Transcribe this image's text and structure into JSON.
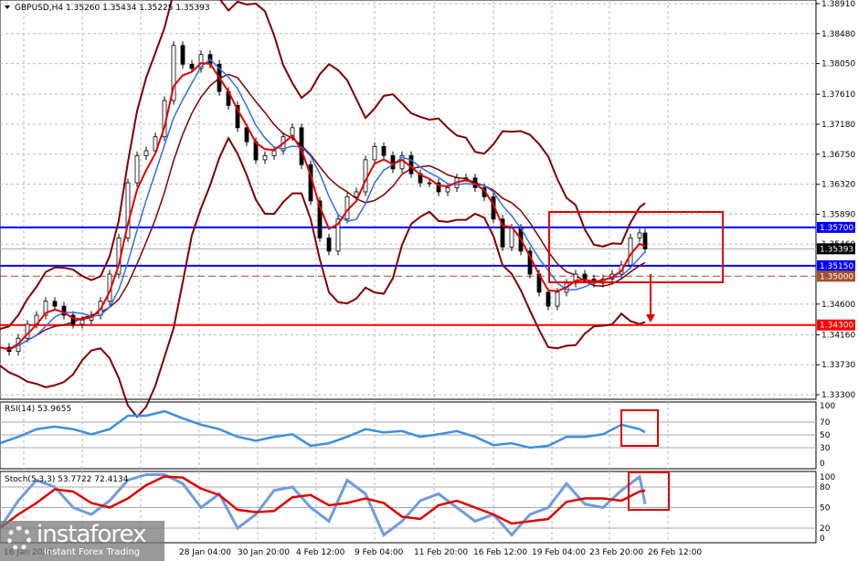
{
  "chart_data": [
    {
      "type": "candlestick",
      "title": "GBPUSD,H4",
      "ohlc_header": {
        "symbol": "GBPUSD,H4",
        "open": "1.35260",
        "high": "1.35434",
        "low": "1.35225",
        "close": "1.35393"
      },
      "ylim": [
        1.333,
        1.3891
      ],
      "y_ticks": [
        "1.38910",
        "1.38480",
        "1.38050",
        "1.37610",
        "1.37180",
        "1.36750",
        "1.36320",
        "1.35890",
        "1.35460",
        "1.34600",
        "1.34160",
        "1.33730",
        "1.33300"
      ],
      "x_ticks": [
        "16 Jan 2026",
        "28 Jan 04:00",
        "30 Jan 20:00",
        "4 Feb 12:00",
        "9 Feb 04:00",
        "11 Feb 20:00",
        "16 Feb 12:00",
        "19 Feb 04:00",
        "23 Feb 20:00",
        "26 Feb 12:00"
      ],
      "closes": [
        1.3398,
        1.3392,
        1.3411,
        1.3431,
        1.3444,
        1.3464,
        1.3457,
        1.3444,
        1.3431,
        1.3437,
        1.3444,
        1.3464,
        1.3503,
        1.3555,
        1.3634,
        1.3673,
        1.368,
        1.37,
        1.3752,
        1.3831,
        1.3804,
        1.3798,
        1.3818,
        1.3804,
        1.3765,
        1.3745,
        1.3713,
        1.3693,
        1.3667,
        1.3673,
        1.368,
        1.37,
        1.3713,
        1.366,
        1.3608,
        1.3555,
        1.3536,
        1.3582,
        1.3614,
        1.3621,
        1.3667,
        1.3686,
        1.3673,
        1.3654,
        1.3673,
        1.3647,
        1.3634,
        1.3634,
        1.3621,
        1.3627,
        1.3641,
        1.3641,
        1.3627,
        1.3614,
        1.3582,
        1.3542,
        1.3569,
        1.3536,
        1.3503,
        1.3477,
        1.3457,
        1.3477,
        1.349,
        1.3503,
        1.3496,
        1.349,
        1.3496,
        1.3503,
        1.3516,
        1.3555,
        1.3562,
        1.35393
      ],
      "levels": [
        {
          "price": 1.357,
          "label": "1.35700",
          "color": "#0000ff"
        },
        {
          "price": 1.3515,
          "label": "1.35150",
          "color": "#0000ff"
        },
        {
          "price": 1.35,
          "label": "1.35000",
          "color": "#a0522d"
        },
        {
          "price": 1.343,
          "label": "1.34300",
          "color": "#ff0000"
        }
      ],
      "current_price": {
        "price": 1.35393,
        "label": "1.35393"
      },
      "colors": {
        "bollinger": "#800000",
        "fast_ma": "#e00000",
        "slow_ma": "#3070e0",
        "annotation": "#e00000"
      }
    },
    {
      "type": "line",
      "title": "RSI(14) 53.9655",
      "ylim": [
        0,
        100
      ],
      "y_ticks": [
        "100",
        "70",
        "50",
        "30",
        "0"
      ],
      "values": [
        37,
        47,
        59,
        63,
        59,
        51,
        59,
        80,
        80,
        87,
        76,
        66,
        59,
        47,
        41,
        47,
        51,
        33,
        37,
        47,
        59,
        54,
        56,
        47,
        51,
        56,
        47,
        34,
        37,
        30,
        33,
        47,
        47,
        51,
        66,
        59,
        54
      ],
      "color": "#3d8fe0"
    },
    {
      "type": "line",
      "title": "Stoch(5,3,3) 53.7722 72.4134",
      "ylim": [
        0,
        100
      ],
      "y_ticks": [
        "100",
        "80",
        "50",
        "20",
        "0"
      ],
      "k_values": [
        20,
        60,
        90,
        80,
        50,
        40,
        60,
        90,
        98,
        98,
        85,
        50,
        70,
        20,
        40,
        75,
        80,
        50,
        30,
        90,
        70,
        10,
        30,
        60,
        70,
        50,
        30,
        40,
        10,
        40,
        50,
        85,
        55,
        50,
        75,
        95,
        55
      ],
      "colors": {
        "k": "#6f9be0",
        "d": "#e00000"
      }
    }
  ],
  "logo": {
    "name": "instaforex",
    "tagline": "Instant Forex Trading"
  }
}
